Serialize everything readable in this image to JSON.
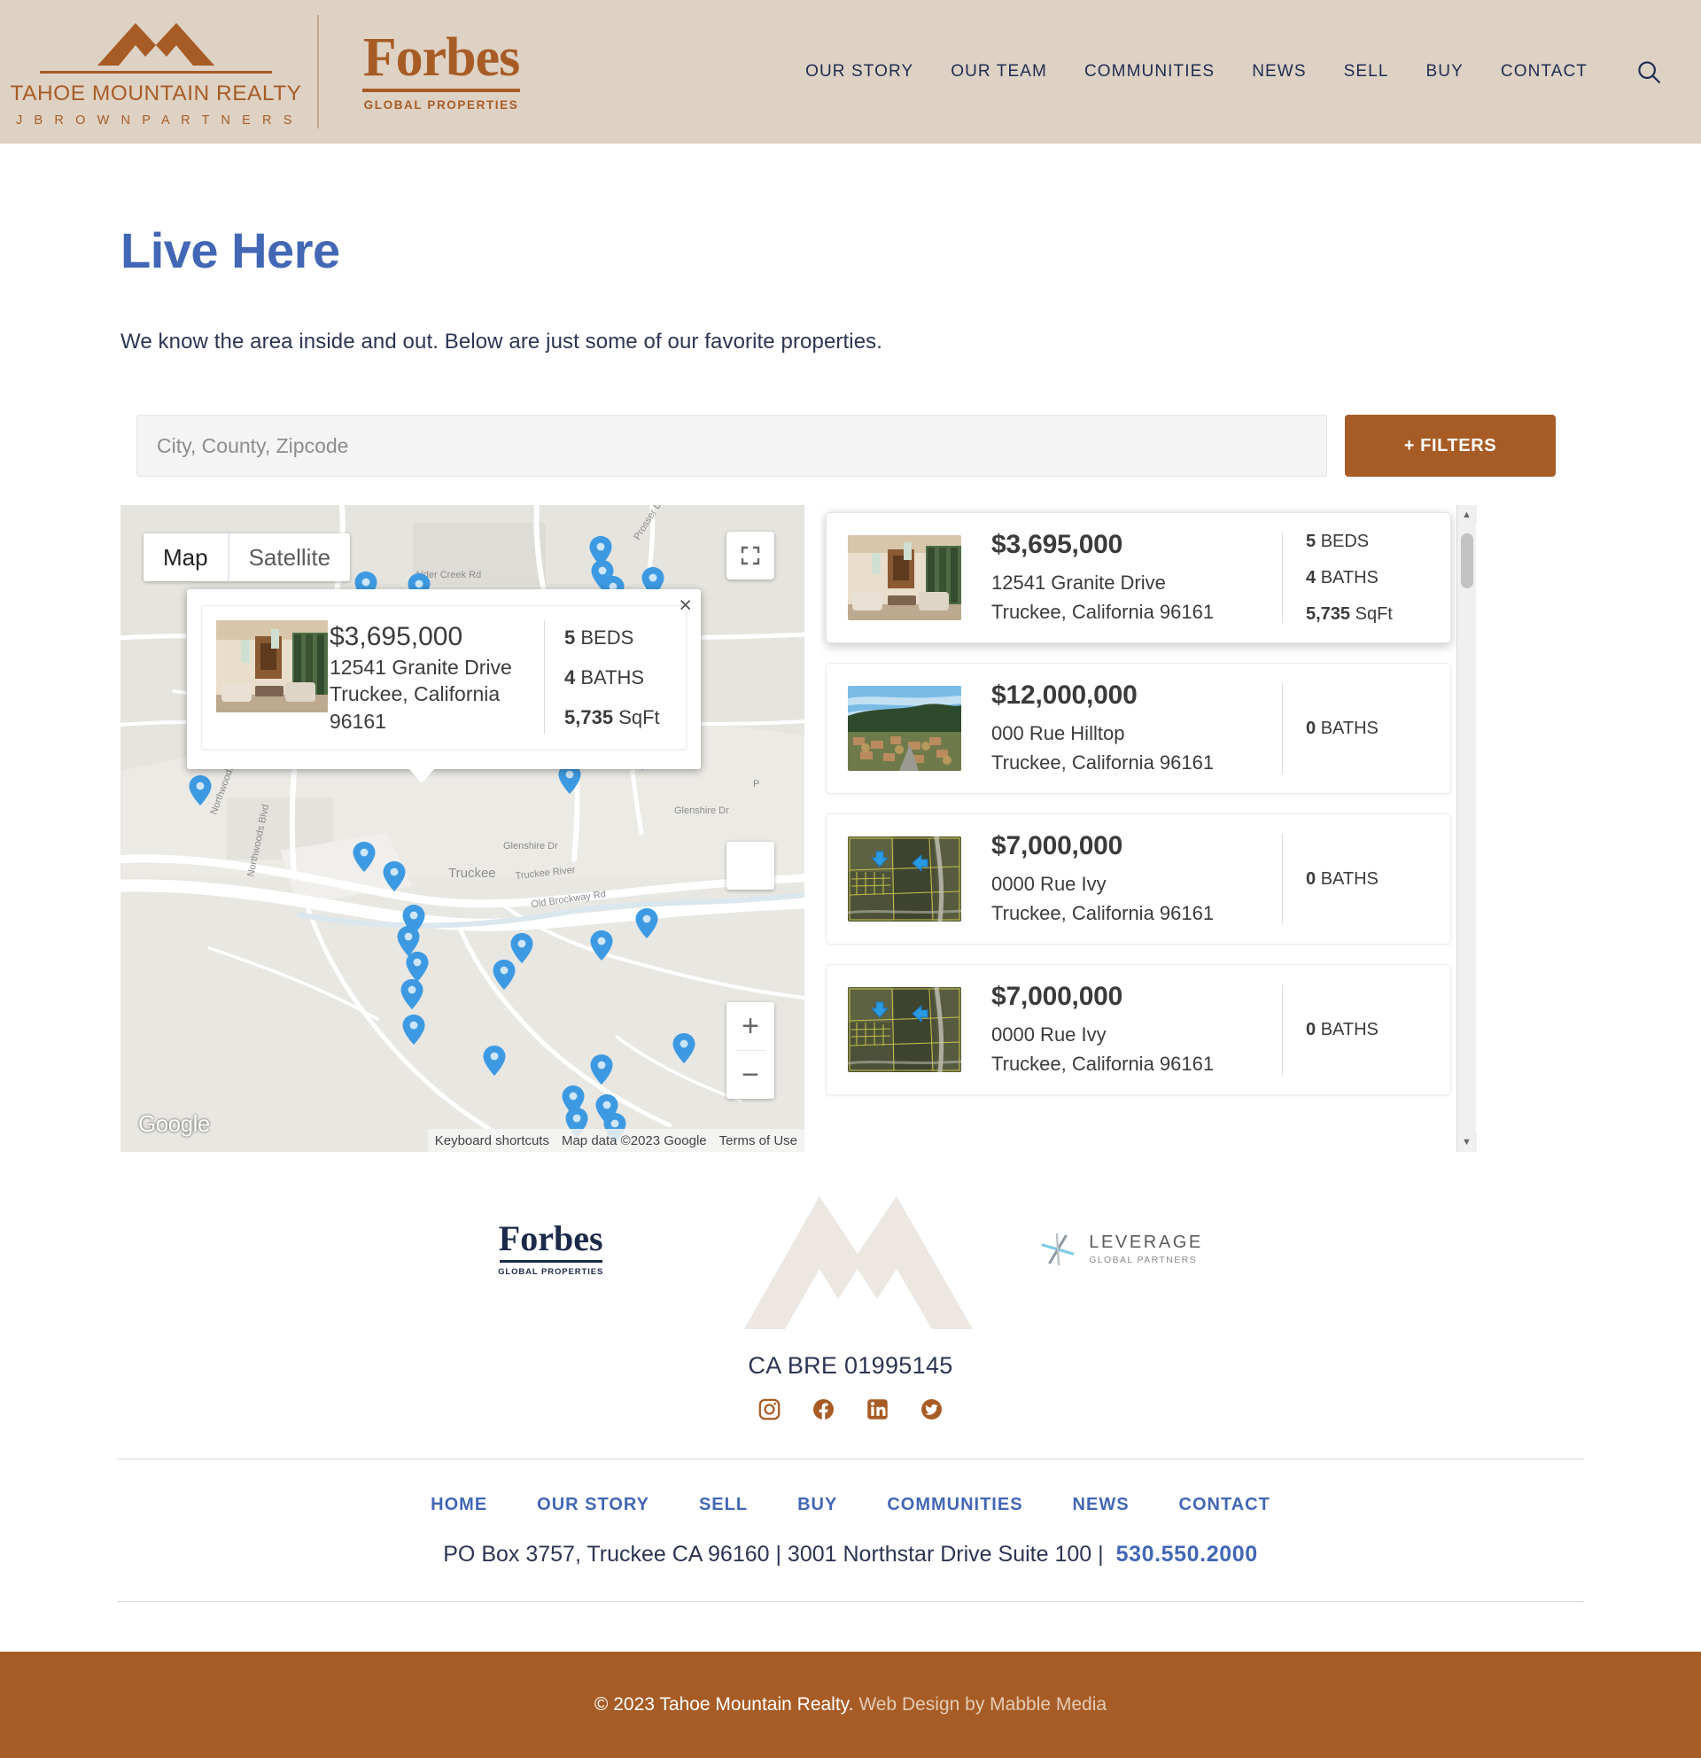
{
  "header": {
    "brand": {
      "name": "TAHOE MOUNTAIN REALTY",
      "tagline": "J  B R O W N  P A R T N E R S",
      "partner_word": "Forbes",
      "partner_sub": "GLOBAL PROPERTIES"
    },
    "nav": [
      {
        "label": "OUR STORY"
      },
      {
        "label": "OUR TEAM"
      },
      {
        "label": "COMMUNITIES"
      },
      {
        "label": "NEWS"
      },
      {
        "label": "SELL"
      },
      {
        "label": "BUY"
      },
      {
        "label": "CONTACT"
      }
    ],
    "search_icon": "search-icon"
  },
  "hero": {
    "title": "Live Here",
    "subtitle": "We know the area inside and out. Below are just some of our favorite properties."
  },
  "search": {
    "placeholder": "City, County, Zipcode",
    "value": "",
    "filters_label": "+ FILTERS"
  },
  "map": {
    "type_buttons": [
      {
        "label": "Map",
        "active": true
      },
      {
        "label": "Satellite",
        "active": false
      }
    ],
    "zoom_in_label": "+",
    "zoom_out_label": "−",
    "watermark": "Google",
    "attribution": [
      {
        "label": "Keyboard shortcuts"
      },
      {
        "label": "Map data ©2023 Google"
      },
      {
        "label": "Terms of Use"
      }
    ],
    "labels": [
      "Prosser Dam Rd",
      "Alder Creek Rd",
      "Alder Creek Rd",
      "Northwoods Blvd",
      "Northwoods Blvd",
      "Glenshire Dr",
      "Glenshire Dr",
      "Truckee River",
      "Truckee",
      "Old Brockway Rd"
    ],
    "info_window": {
      "close_label": "×",
      "price": "$3,695,000",
      "address_line1": "12541 Granite Drive",
      "address_line2": "Truckee, California",
      "address_line3": "96161",
      "stats": [
        {
          "value": "5",
          "unit": "BEDS"
        },
        {
          "value": "4",
          "unit": "BATHS"
        },
        {
          "value": "5,735",
          "unit": "SqFt"
        }
      ]
    }
  },
  "listings": [
    {
      "price": "$3,695,000",
      "address_line1": "12541 Granite Drive",
      "address_line2": "Truckee, California 96161",
      "featured": true,
      "thumb": "interior-living-room",
      "stats": [
        {
          "value": "5",
          "unit": "BEDS"
        },
        {
          "value": "4",
          "unit": "BATHS"
        },
        {
          "value": "5,735",
          "unit": "SqFt"
        }
      ]
    },
    {
      "price": "$12,000,000",
      "address_line1": "000 Rue Hilltop",
      "address_line2": "Truckee, California 96161",
      "featured": false,
      "thumb": "town-aerial",
      "stats": [
        {
          "value": "0",
          "unit": "BATHS"
        }
      ]
    },
    {
      "price": "$7,000,000",
      "address_line1": "0000 Rue Ivy",
      "address_line2": "Truckee, California 96161",
      "featured": false,
      "thumb": "parcel-satellite",
      "stats": [
        {
          "value": "0",
          "unit": "BATHS"
        }
      ]
    },
    {
      "price": "$7,000,000",
      "address_line1": "0000 Rue Ivy",
      "address_line2": "Truckee, California 96161",
      "featured": false,
      "thumb": "parcel-satellite",
      "stats": [
        {
          "value": "0",
          "unit": "BATHS"
        }
      ]
    }
  ],
  "footer": {
    "forbes_word": "Forbes",
    "forbes_sub": "GLOBAL PROPERTIES",
    "leverage_name": "LEVERAGE",
    "leverage_sub": "GLOBAL PARTNERS",
    "bre": "CA BRE 01995145",
    "social": [
      {
        "name": "instagram-icon"
      },
      {
        "name": "facebook-icon"
      },
      {
        "name": "linkedin-icon"
      },
      {
        "name": "twitter-icon"
      }
    ],
    "nav": [
      {
        "label": "HOME"
      },
      {
        "label": "OUR STORY"
      },
      {
        "label": "SELL"
      },
      {
        "label": "BUY"
      },
      {
        "label": "COMMUNITIES"
      },
      {
        "label": "NEWS"
      },
      {
        "label": "CONTACT"
      }
    ],
    "address": "PO Box 3757, Truckee CA 96160 | 3001 Northstar Drive Suite 100 |",
    "phone": "530.550.2000",
    "copyright": "© 2023 Tahoe Mountain Realty.",
    "credit": "Web Design by Mabble Media"
  },
  "colors": {
    "brand_brown": "#a85c25",
    "header_bg": "#ded2c4",
    "accent_blue": "#4267b5",
    "navy": "#1e2c53"
  }
}
